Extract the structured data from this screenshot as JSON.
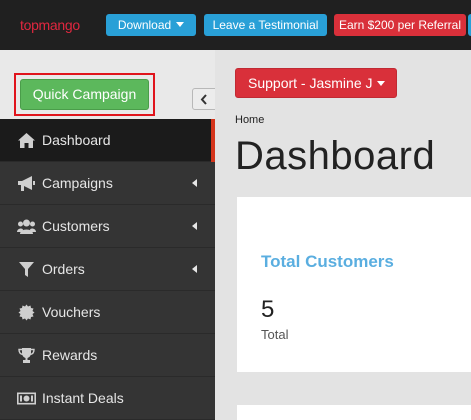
{
  "header": {
    "logo": "topmango",
    "download_label": "Download",
    "testimonial_label": "Leave a Testimonial",
    "referral_label": "Earn $200 per Referral"
  },
  "sidebar": {
    "quick_campaign_label": "Quick Campaign",
    "collapse_icon": "chevron-left-icon",
    "items": [
      {
        "label": "Dashboard",
        "icon": "home-icon",
        "active": true,
        "has_submenu": false
      },
      {
        "label": "Campaigns",
        "icon": "bullhorn-icon",
        "active": false,
        "has_submenu": true
      },
      {
        "label": "Customers",
        "icon": "users-icon",
        "active": false,
        "has_submenu": true
      },
      {
        "label": "Orders",
        "icon": "filter-icon",
        "active": false,
        "has_submenu": true
      },
      {
        "label": "Vouchers",
        "icon": "certificate-icon",
        "active": false,
        "has_submenu": false
      },
      {
        "label": "Rewards",
        "icon": "trophy-icon",
        "active": false,
        "has_submenu": false
      },
      {
        "label": "Instant Deals",
        "icon": "money-icon",
        "active": false,
        "has_submenu": false
      }
    ]
  },
  "main": {
    "account_label": "Support - Jasmine J",
    "breadcrumb": "Home",
    "title": "Dashboard",
    "card": {
      "title": "Total Customers",
      "value": "5",
      "sub": "Total"
    }
  },
  "colors": {
    "brand_red": "#e0273f",
    "info_blue": "#29a0d7",
    "danger_red": "#d9303a",
    "success_green": "#5cb85c",
    "sidebar_dark": "#343434",
    "card_title_blue": "#5aaee0"
  }
}
